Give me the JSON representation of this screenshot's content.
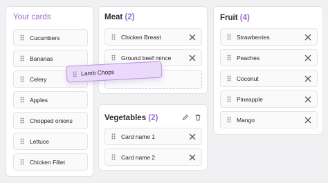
{
  "your_cards": {
    "title": "Your cards",
    "items": [
      "Cucumbers",
      "Bananas",
      "Celery",
      "Apples",
      "Chopped onions",
      "Lettuce",
      "Chicken Fillet"
    ]
  },
  "meat": {
    "title": "Meat",
    "count": "(2)",
    "items": [
      "Chicken Breast",
      "Ground beef mince"
    ]
  },
  "dragging_card": {
    "label": "Lamb Chops"
  },
  "vegetables": {
    "title": "Vegetables",
    "count": "(2)",
    "items": [
      "Card name 1",
      "Card name 2"
    ],
    "edit_icon": "pencil-icon",
    "delete_icon": "trash-icon"
  },
  "fruit": {
    "title": "Fruit",
    "count": "(4)",
    "items": [
      "Strawberries",
      "Peaches",
      "Coconut",
      "Pineapple",
      "Mango"
    ]
  },
  "colors": {
    "accent": "#9b6ad1",
    "drag_card_bg": "#ead9fb",
    "panel_bg": "#ffffff",
    "page_bg": "#f1f1f3"
  }
}
